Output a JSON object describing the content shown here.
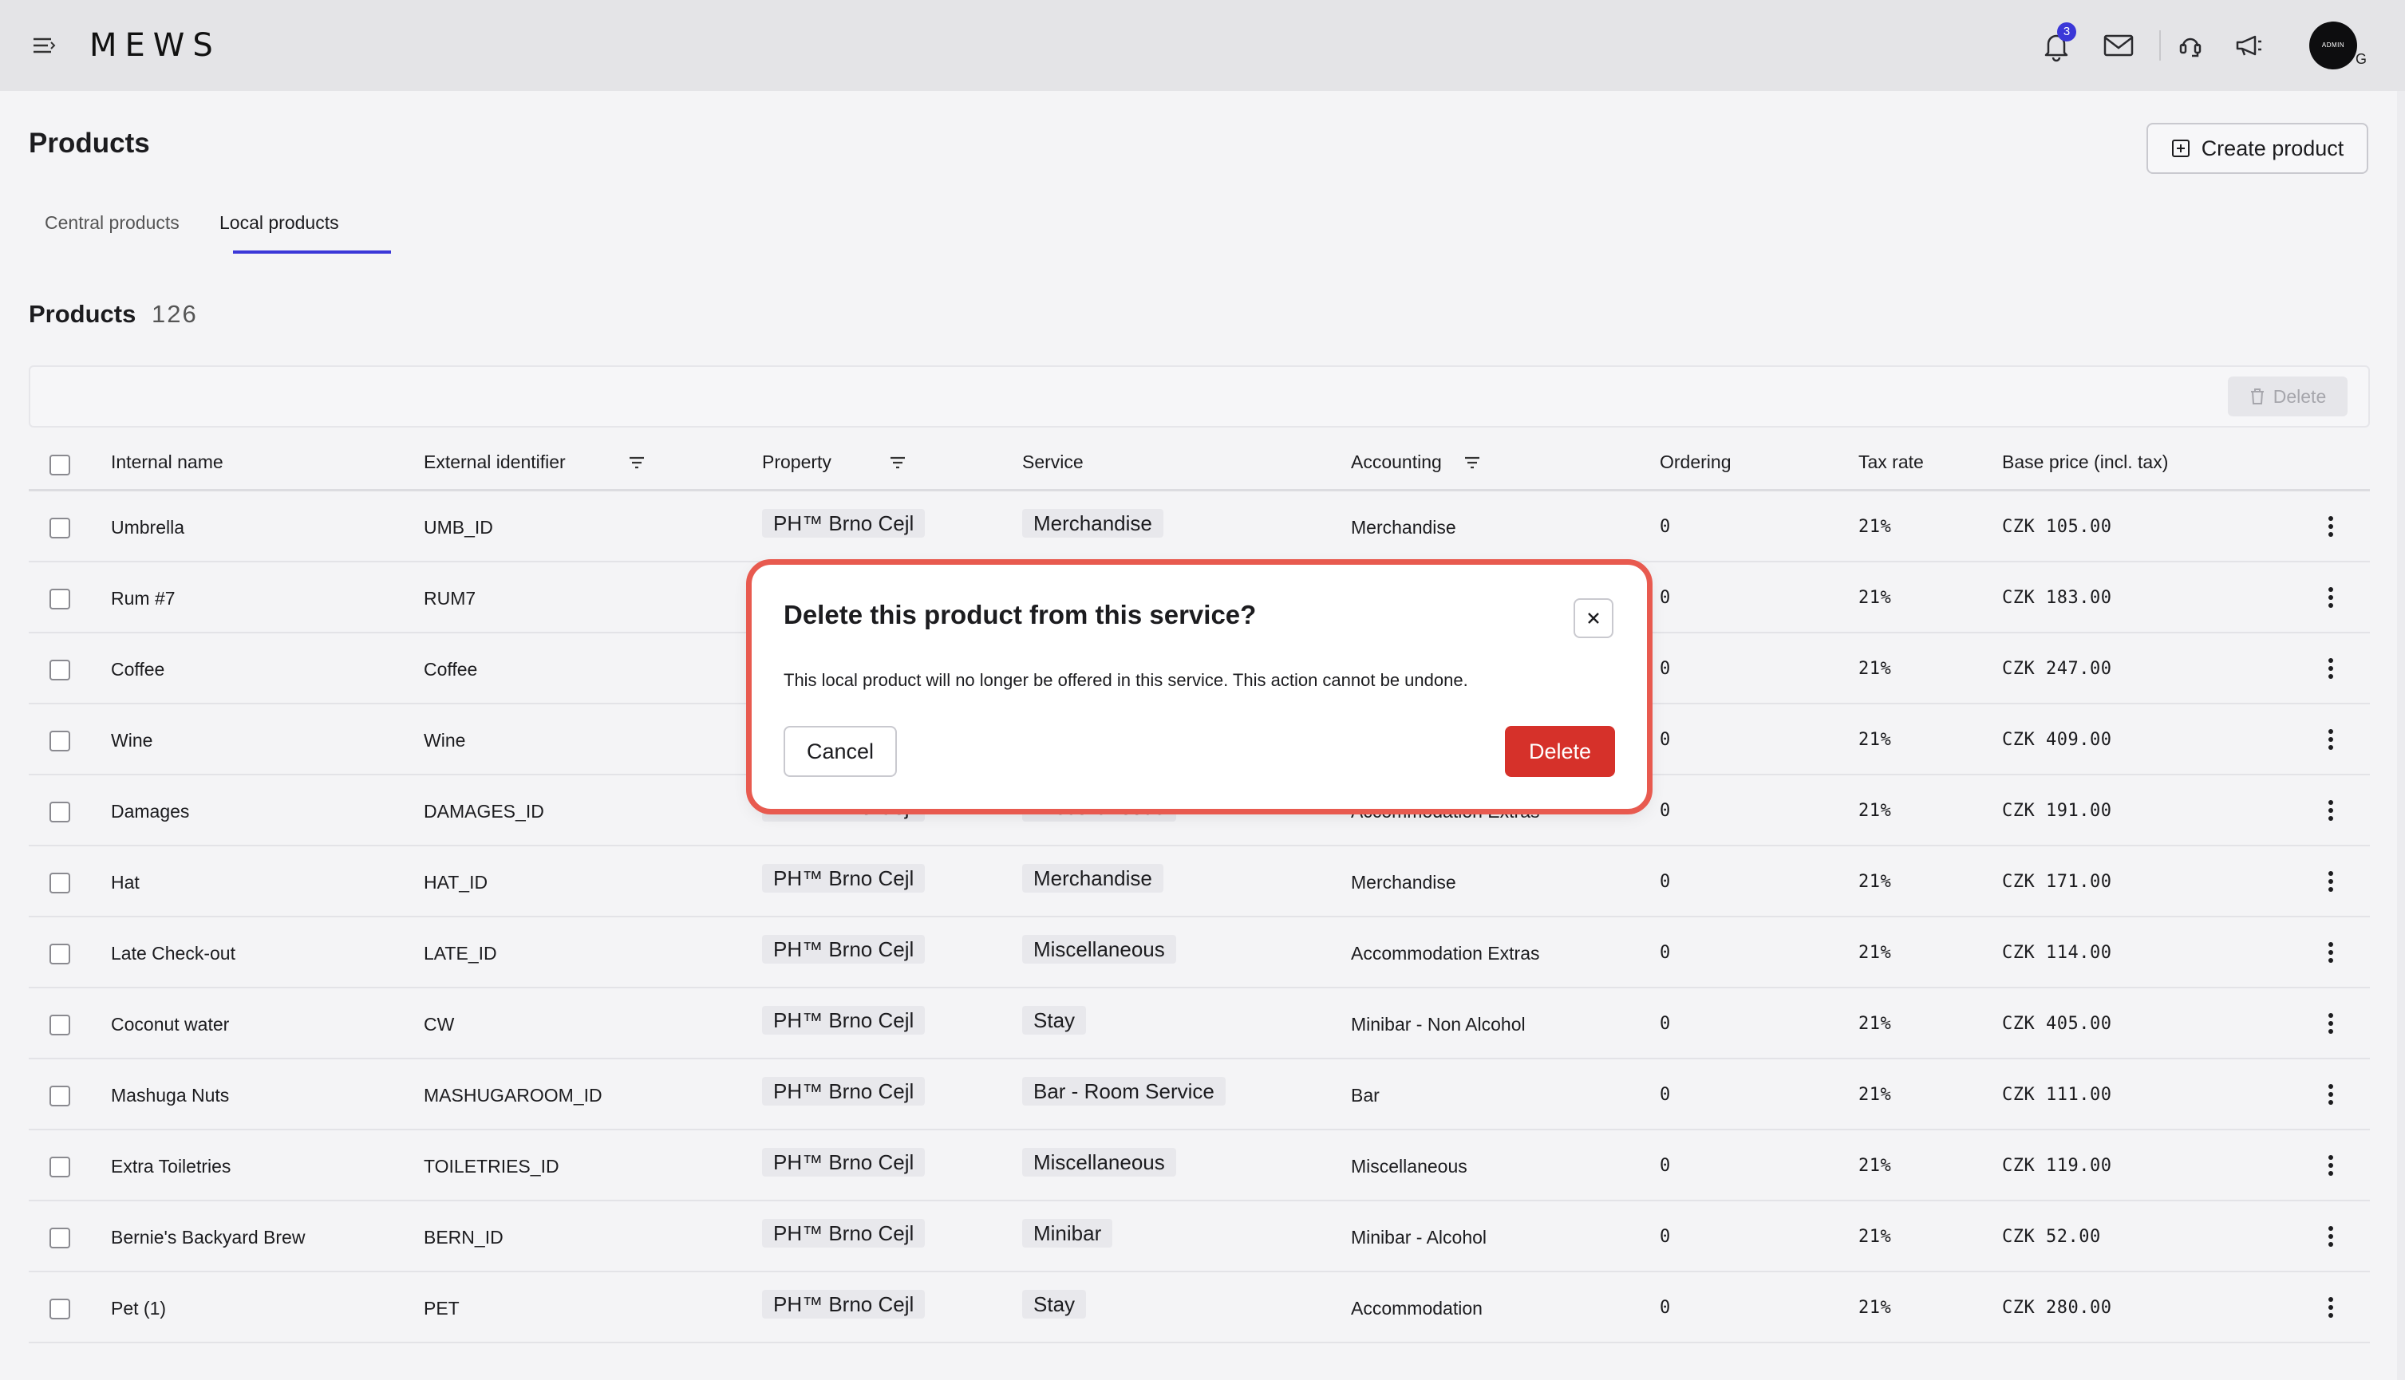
{
  "header": {
    "logo": "MEWS",
    "notification_count": "3",
    "avatar_text": "ADMIN",
    "avatar_letter": "G"
  },
  "page": {
    "title": "Products",
    "create_button": "Create product",
    "tabs": [
      {
        "label": "Central products",
        "active": false
      },
      {
        "label": "Local products",
        "active": true
      }
    ],
    "section_title": "Products",
    "section_count": "126",
    "toolbar_delete": "Delete"
  },
  "table": {
    "columns": {
      "internal_name": "Internal name",
      "external_identifier": "External identifier",
      "property": "Property",
      "service": "Service",
      "accounting": "Accounting",
      "ordering": "Ordering",
      "tax_rate": "Tax rate",
      "base_price": "Base price (incl. tax)"
    },
    "rows": [
      {
        "name": "Umbrella",
        "ext": "UMB_ID",
        "property": "PH™ Brno Cejl",
        "service": "Merchandise",
        "accounting": "Merchandise",
        "ordering": "0",
        "tax": "21%",
        "price": "CZK 105.00"
      },
      {
        "name": "Rum #7",
        "ext": "RUM7",
        "property": "",
        "service": "",
        "accounting": "",
        "ordering": "0",
        "tax": "21%",
        "price": "CZK 183.00"
      },
      {
        "name": "Coffee",
        "ext": "Coffee",
        "property": "",
        "service": "",
        "accounting": "",
        "ordering": "0",
        "tax": "21%",
        "price": "CZK 247.00"
      },
      {
        "name": "Wine",
        "ext": "Wine",
        "property": "",
        "service": "",
        "accounting": "",
        "ordering": "0",
        "tax": "21%",
        "price": "CZK 409.00"
      },
      {
        "name": "Damages",
        "ext": "DAMAGES_ID",
        "property": "PH™ Brno Cejl",
        "service": "Miscellaneous",
        "accounting": "Accommodation Extras",
        "ordering": "0",
        "tax": "21%",
        "price": "CZK 191.00"
      },
      {
        "name": "Hat",
        "ext": "HAT_ID",
        "property": "PH™ Brno Cejl",
        "service": "Merchandise",
        "accounting": "Merchandise",
        "ordering": "0",
        "tax": "21%",
        "price": "CZK 171.00"
      },
      {
        "name": "Late Check-out",
        "ext": "LATE_ID",
        "property": "PH™ Brno Cejl",
        "service": "Miscellaneous",
        "accounting": "Accommodation Extras",
        "ordering": "0",
        "tax": "21%",
        "price": "CZK 114.00"
      },
      {
        "name": "Coconut water",
        "ext": "CW",
        "property": "PH™ Brno Cejl",
        "service": "Stay",
        "accounting": "Minibar - Non Alcohol",
        "ordering": "0",
        "tax": "21%",
        "price": "CZK 405.00"
      },
      {
        "name": "Mashuga Nuts",
        "ext": "MASHUGAROOM_ID",
        "property": "PH™ Brno Cejl",
        "service": "Bar - Room Service",
        "accounting": "Bar",
        "ordering": "0",
        "tax": "21%",
        "price": "CZK 111.00"
      },
      {
        "name": "Extra Toiletries",
        "ext": "TOILETRIES_ID",
        "property": "PH™ Brno Cejl",
        "service": "Miscellaneous",
        "accounting": "Miscellaneous",
        "ordering": "0",
        "tax": "21%",
        "price": "CZK 119.00"
      },
      {
        "name": "Bernie's Backyard Brew",
        "ext": "BERN_ID",
        "property": "PH™ Brno Cejl",
        "service": "Minibar",
        "accounting": "Minibar - Alcohol",
        "ordering": "0",
        "tax": "21%",
        "price": "CZK 52.00"
      },
      {
        "name": "Pet (1)",
        "ext": "PET",
        "property": "PH™ Brno Cejl",
        "service": "Stay",
        "accounting": "Accommodation",
        "ordering": "0",
        "tax": "21%",
        "price": "CZK 280.00"
      }
    ]
  },
  "modal": {
    "title": "Delete this product from this service?",
    "body": "This local product will no longer be offered in this service. This action cannot be undone.",
    "cancel": "Cancel",
    "delete": "Delete"
  },
  "colors": {
    "accent": "#3b37d8",
    "danger": "#d6312a",
    "highlight_outline": "#e85a4f"
  }
}
